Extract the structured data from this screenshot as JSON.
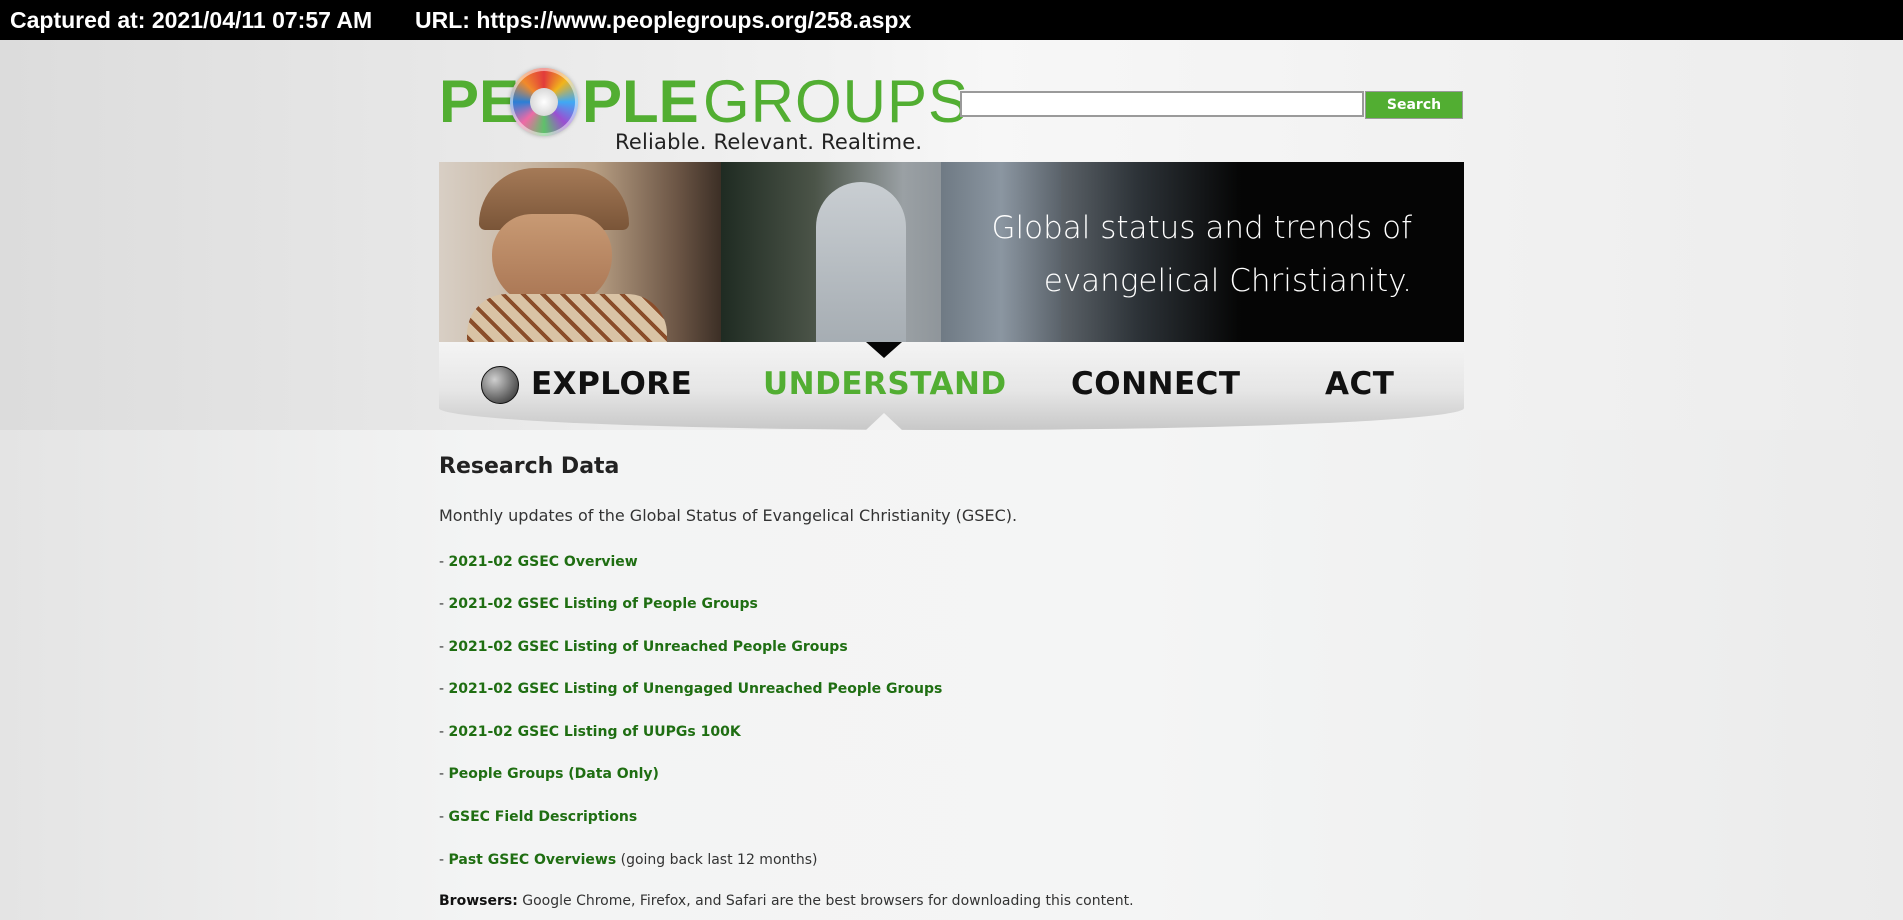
{
  "capture": {
    "captured_label": "Captured at: 2021/04/11 07:57 AM",
    "url_label": "URL: https://www.peoplegroups.org/258.aspx"
  },
  "logo": {
    "word_pe": "PE",
    "word_ple": "PLE",
    "word_groups": "GROUPS",
    "tagline": "Reliable. Relevant. Realtime."
  },
  "search": {
    "placeholder": "",
    "value": "",
    "button_label": "Search"
  },
  "banner": {
    "line1": "Global status and trends of",
    "line2": "evangelical Christianity."
  },
  "nav": {
    "items": [
      {
        "label": "EXPLORE",
        "active": false
      },
      {
        "label": "UNDERSTAND",
        "active": true
      },
      {
        "label": "CONNECT",
        "active": false
      },
      {
        "label": "ACT",
        "active": false
      }
    ]
  },
  "content": {
    "title": "Research Data",
    "intro": "Monthly updates of the Global Status of Evangelical Christianity (GSEC).",
    "links": [
      {
        "prefix": "- ",
        "label": "2021-02 GSEC Overview",
        "suffix": ""
      },
      {
        "prefix": "- ",
        "label": "2021-02 GSEC Listing of People Groups",
        "suffix": ""
      },
      {
        "prefix": "- ",
        "label": "2021-02 GSEC Listing of Unreached People Groups",
        "suffix": ""
      },
      {
        "prefix": "- ",
        "label": "2021-02 GSEC Listing of Unengaged Unreached People Groups",
        "suffix": ""
      },
      {
        "prefix": "- ",
        "label": "2021-02 GSEC Listing of UUPGs 100K",
        "suffix": ""
      },
      {
        "prefix": "- ",
        "label": "People Groups (Data Only)",
        "suffix": ""
      },
      {
        "prefix": "- ",
        "label": "GSEC Field Descriptions",
        "suffix": ""
      },
      {
        "prefix": "- ",
        "label": "Past GSEC Overviews",
        "suffix": " (going back last 12 months)"
      }
    ],
    "browsers_label": "Browsers:",
    "browsers_text": " Google Chrome, Firefox, and Safari are the best browsers for downloading this content."
  },
  "colors": {
    "brand_green": "#52ae32",
    "link_green": "#1f6e12",
    "capture_bar": "#000000"
  }
}
